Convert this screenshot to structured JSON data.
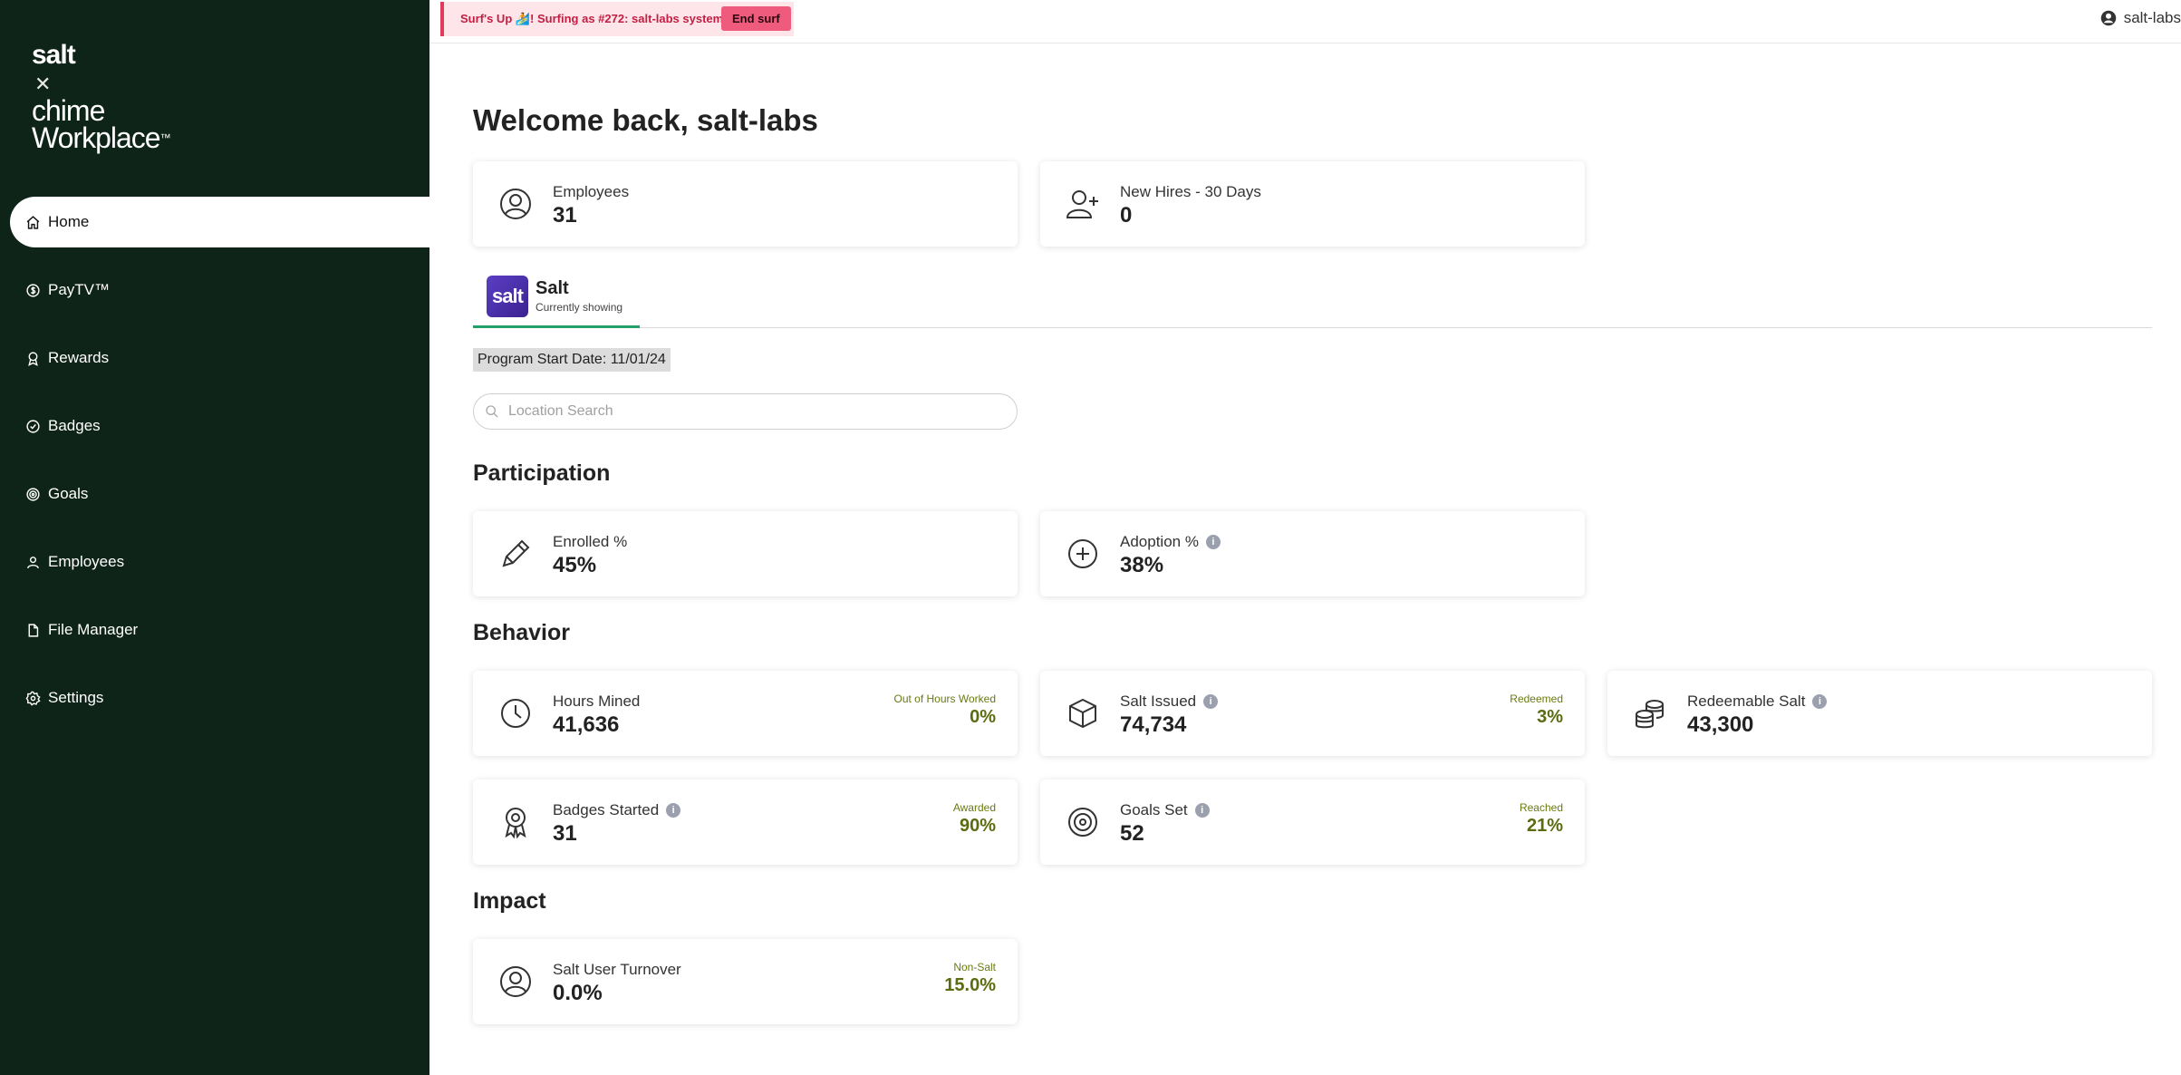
{
  "brand": {
    "salt": "salt",
    "x": "✕",
    "chime": "chime",
    "workplace": "Workplace",
    "tm": "™"
  },
  "nav": {
    "items": [
      {
        "label": "Home",
        "icon": "home-icon"
      },
      {
        "label": "PayTV™",
        "icon": "dollar-circle-icon"
      },
      {
        "label": "Rewards",
        "icon": "award-icon"
      },
      {
        "label": "Badges",
        "icon": "check-circle-icon"
      },
      {
        "label": "Goals",
        "icon": "target-icon"
      },
      {
        "label": "Employees",
        "icon": "user-icon"
      },
      {
        "label": "File Manager",
        "icon": "file-icon"
      },
      {
        "label": "Settings",
        "icon": "gear-icon"
      }
    ]
  },
  "topbar": {
    "surf_text": "Surf's Up 🏄! Surfing as #272: salt-labs system",
    "end_surf": "End surf",
    "user": "salt-labs"
  },
  "main": {
    "title": "Welcome back, salt-labs",
    "summary": {
      "employees_label": "Employees",
      "employees_value": "31",
      "new_hires_label": "New Hires - 30 Days",
      "new_hires_value": "0"
    },
    "tab": {
      "logo": "salt",
      "name": "Salt",
      "sub": "Currently showing"
    },
    "program_start": "Program Start Date: 11/01/24",
    "search_placeholder": "Location Search",
    "sections": {
      "participation": "Participation",
      "behavior": "Behavior",
      "impact": "Impact"
    },
    "participation": {
      "enrolled_label": "Enrolled %",
      "enrolled_value": "45%",
      "adoption_label": "Adoption %",
      "adoption_value": "38%"
    },
    "behavior": {
      "hours_label": "Hours Mined",
      "hours_value": "41,636",
      "hours_sub_label": "Out of Hours Worked",
      "hours_sub_value": "0%",
      "salt_issued_label": "Salt Issued",
      "salt_issued_value": "74,734",
      "salt_issued_sub_label": "Redeemed",
      "salt_issued_sub_value": "3%",
      "redeemable_label": "Redeemable Salt",
      "redeemable_value": "43,300",
      "badges_label": "Badges Started",
      "badges_value": "31",
      "badges_sub_label": "Awarded",
      "badges_sub_value": "90%",
      "goals_label": "Goals Set",
      "goals_value": "52",
      "goals_sub_label": "Reached",
      "goals_sub_value": "21%"
    },
    "impact": {
      "turnover_label": "Salt User Turnover",
      "turnover_value": "0.0%",
      "turnover_sub_label": "Non-Salt",
      "turnover_sub_value": "15.0%"
    },
    "info": "i"
  }
}
